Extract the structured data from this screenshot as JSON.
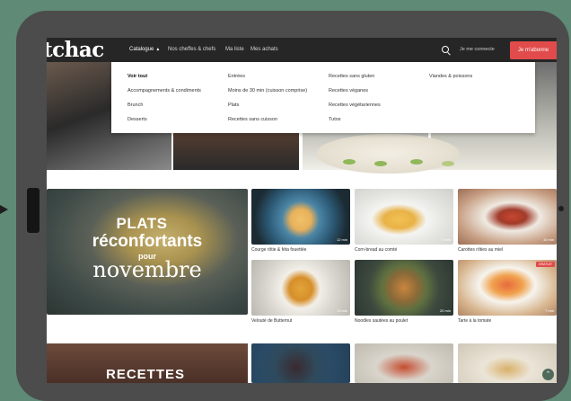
{
  "navbar": {
    "logo": "tchac",
    "catalogue": "Catalogue",
    "links": [
      "Nos cheffes & chefs",
      "Ma liste",
      "Mes achats"
    ],
    "login": "Je me connecte",
    "subscribe": "Je m'abonne"
  },
  "dropdown": {
    "col1": [
      "Voir tout",
      "Accompagnements & condiments",
      "Brunch",
      "Desserts"
    ],
    "col2": [
      "Entrées",
      "Moins de 30 min (cuisson comprise)",
      "Plats",
      "Recettes sans cuisson"
    ],
    "col3": [
      "Recettes sans gluten",
      "Recettes véganes",
      "Recettes végétariennes",
      "Tutos"
    ],
    "col4": [
      "Viandes & poissons"
    ]
  },
  "banner": {
    "line1": "PLATS",
    "line2": "réconfortants",
    "line3": "pour",
    "line4": "novembre"
  },
  "cards": [
    {
      "title": "Courge rôtie & féta fouettée",
      "duration": "12 min"
    },
    {
      "title": "Corn-bread au comté",
      "duration": "7 min"
    },
    {
      "title": "Carottes rôties au miel",
      "duration": "10 min"
    },
    {
      "title": "Velouté de Butternut",
      "duration": "13 min"
    },
    {
      "title": "Noodles sautées au poulet",
      "duration": "20 min"
    },
    {
      "title": "Tarte à la tomate",
      "duration": "7 min",
      "badge": "GRATUIT"
    }
  ],
  "bottom_banner": "RECETTES",
  "colors": {
    "accent": "#e24b4b",
    "nav_bg": "#262626",
    "background": "#5e8a76",
    "tablet": "#4c4c4c"
  }
}
